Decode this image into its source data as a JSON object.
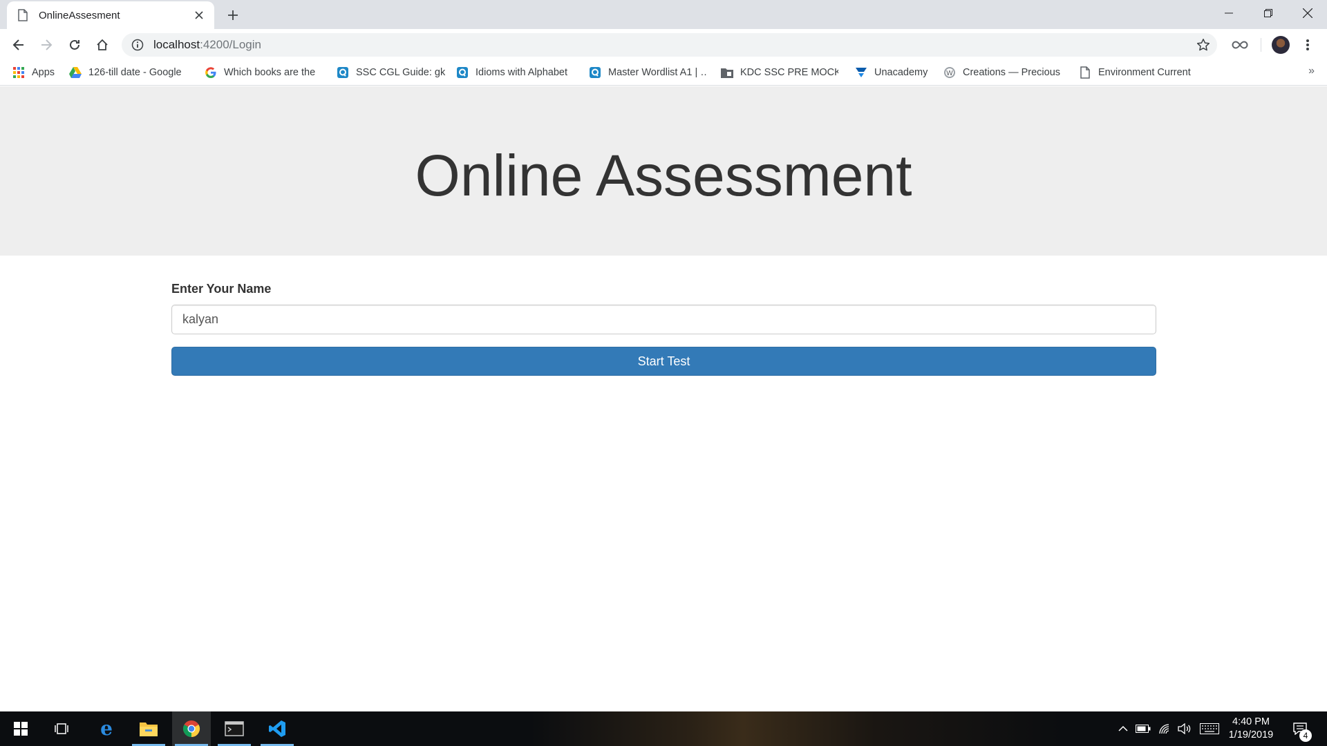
{
  "browser": {
    "tab_title": "OnlineAssesment",
    "url_host": "localhost",
    "url_rest": ":4200/Login",
    "bookmarks": [
      {
        "label": "Apps",
        "icon": "apps-grid-icon"
      },
      {
        "label": "126-till date - Google",
        "icon": "google-drive-icon"
      },
      {
        "label": "Which books are the",
        "icon": "google-icon"
      },
      {
        "label": "SSC CGL Guide: gk",
        "icon": "quora-icon"
      },
      {
        "label": "Idioms with Alphabet",
        "icon": "quora-icon"
      },
      {
        "label": "Master Wordlist A1 | …",
        "icon": "quora-icon"
      },
      {
        "label": "KDC SSC PRE MOCK",
        "icon": "folder-icon"
      },
      {
        "label": "Unacademy",
        "icon": "unacademy-icon"
      },
      {
        "label": "Creations — Precious",
        "icon": "wordpress-icon"
      },
      {
        "label": "Environment Current",
        "icon": "page-icon"
      }
    ],
    "more_bookmarks": "»"
  },
  "page": {
    "title": "Online Assessment",
    "form": {
      "name_label": "Enter Your Name",
      "name_value": "kalyan",
      "start_button": "Start Test"
    }
  },
  "taskbar": {
    "time": "4:40 PM",
    "date": "1/19/2019",
    "notification_count": "4"
  },
  "colors": {
    "primary_button": "#337ab7",
    "jumbotron_bg": "#eeeeee",
    "heading_text": "#333333"
  }
}
